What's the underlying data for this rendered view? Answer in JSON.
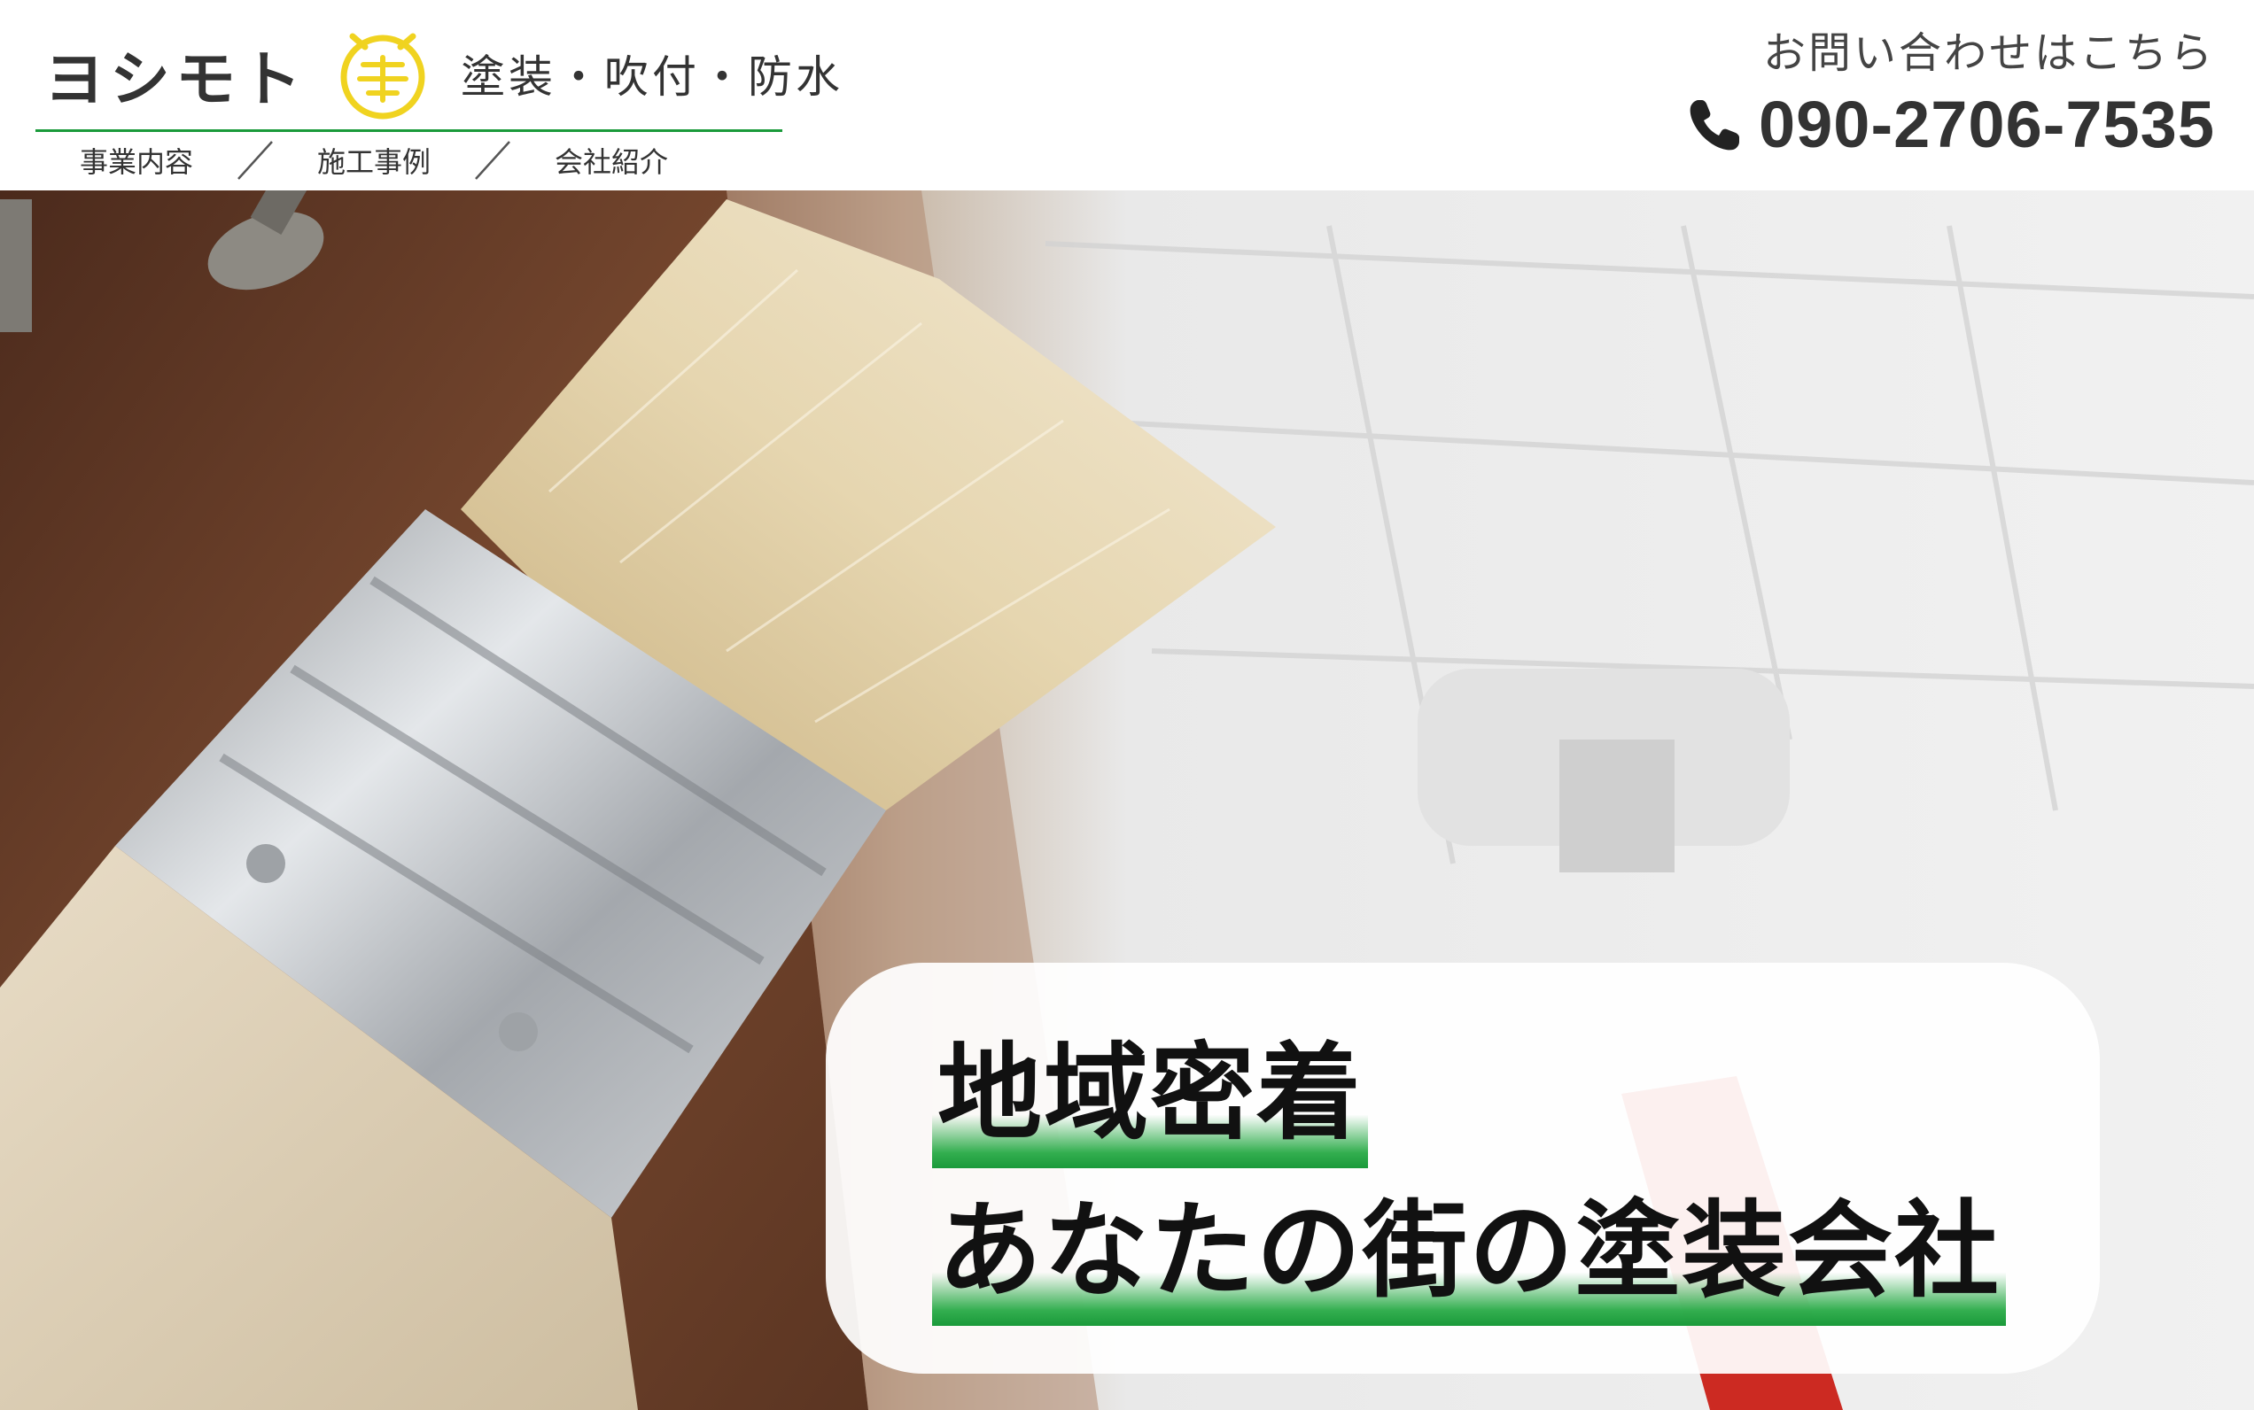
{
  "header": {
    "brand_name": "ヨシモト",
    "tagline": "塗装・吹付・防水",
    "logo_icon": "yoshimoto-logo-icon",
    "accent_color": "#1a9a3a",
    "logo_color": "#f0d320",
    "nav": [
      {
        "label": "事業内容"
      },
      {
        "label": "施工事例"
      },
      {
        "label": "会社紹介"
      }
    ],
    "contact_label": "お問い合わせはこちら",
    "phone_icon": "phone-icon",
    "phone": "090-2706-7535"
  },
  "hero": {
    "catch_line_1": "地域密着",
    "catch_line_2": "あなたの街の塗装会社",
    "highlight_color": "#1a9a3a"
  }
}
